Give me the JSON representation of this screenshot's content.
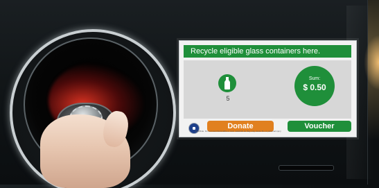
{
  "screen": {
    "header_text": "Recycle eligible glass containers here.",
    "bottle_count": "5",
    "sum_label": "Sum:",
    "sum_value": "$ 0.50",
    "buttons": {
      "donate": "Donate",
      "voucher": "Voucher"
    },
    "fineprint": "CashRide: Do not insert flammable or toxic materials as they may cause fire or personal injury"
  },
  "icons": {
    "bottle": "bottle-icon",
    "flag": "flag-icon"
  },
  "colors": {
    "accent_green": "#1f8f3a",
    "donate_orange": "#e1801f",
    "intake_glow_red": "#ff3c28"
  }
}
